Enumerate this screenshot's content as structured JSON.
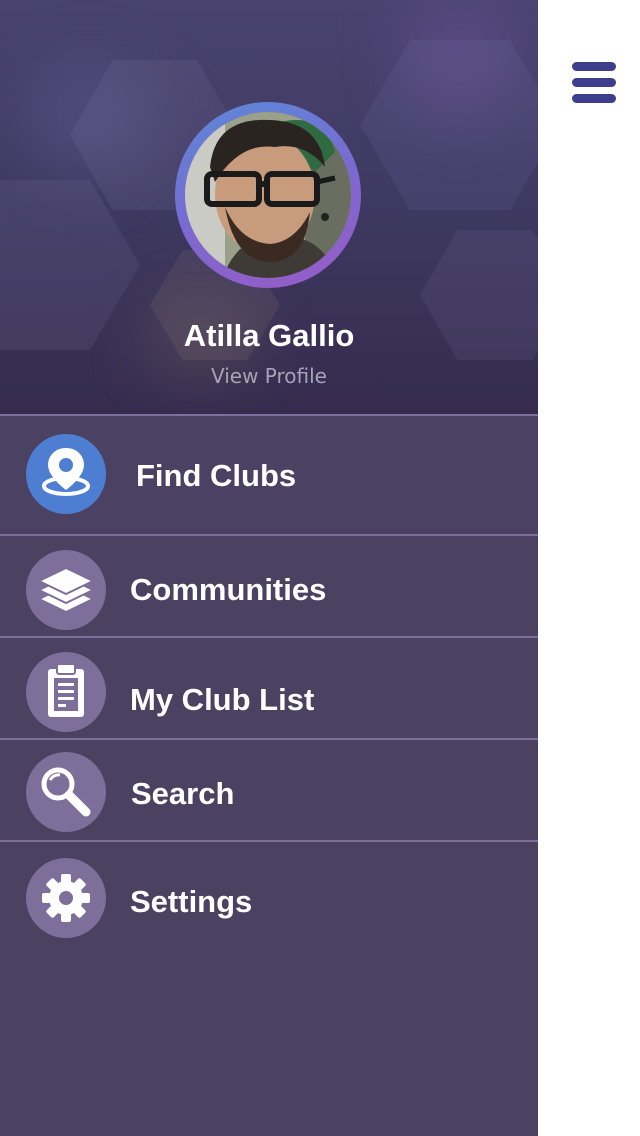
{
  "profile": {
    "name": "Atilla Gallio",
    "view_profile_label": "View Profile"
  },
  "menu": {
    "items": [
      {
        "label": "Find Clubs",
        "icon": "location-pin-icon",
        "active": true
      },
      {
        "label": "Communities",
        "icon": "layers-icon",
        "active": false
      },
      {
        "label": "My Club List",
        "icon": "clipboard-icon",
        "active": false
      },
      {
        "label": "Search",
        "icon": "magnifier-icon",
        "active": false
      },
      {
        "label": "Settings",
        "icon": "gear-icon",
        "active": false
      }
    ]
  },
  "toolbar": {
    "menu_icon": "hamburger-menu-icon"
  },
  "colors": {
    "drawer_background": "#4b4161",
    "active_icon": "#4e7ed2",
    "icon_circle": "#7e6e9a",
    "divider": "#7c6f9e",
    "hamburger": "#3d3e8c",
    "text": "#ffffff",
    "muted_text": "#a8a2b6"
  }
}
